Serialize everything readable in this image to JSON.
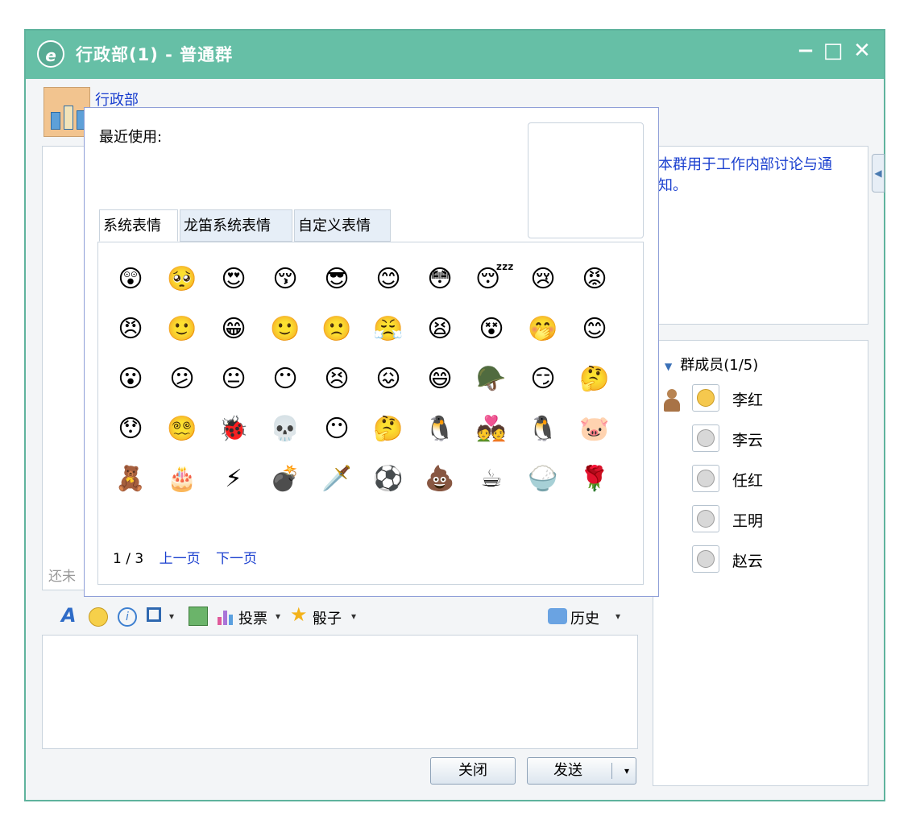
{
  "window": {
    "title": "行政部(1) - 普通群",
    "controls": {
      "minimize": "−",
      "maximize": "□",
      "close": "✕"
    },
    "accent": "#66bfa6"
  },
  "header": {
    "group_name": "行政部"
  },
  "chat": {
    "notice_cut": "还未"
  },
  "notice": {
    "text": "本群用于工作内部讨论与通知。"
  },
  "members": {
    "title": "群成员(1/5)",
    "list": [
      {
        "name": "李红",
        "online": true
      },
      {
        "name": "李云",
        "online": false
      },
      {
        "name": "任红",
        "online": false
      },
      {
        "name": "王明",
        "online": false
      },
      {
        "name": "赵云",
        "online": false
      }
    ]
  },
  "toolbar": {
    "vote_label": "投票",
    "dice_label": "骰子",
    "history_label": "历史",
    "caret": "▾"
  },
  "buttons": {
    "close": "关闭",
    "send": "发送",
    "send_caret": "▾"
  },
  "emoji_popup": {
    "recent_label": "最近使用:",
    "tabs": [
      "系统表情",
      "龙笛系统表情",
      "自定义表情"
    ],
    "pager": {
      "current": "1 / 3",
      "prev": "上一页",
      "next": "下一页"
    },
    "emojis": [
      "😲",
      "🥺",
      "😍",
      "😚",
      "😎",
      "😊",
      "😳",
      "😴",
      "😢",
      "😡",
      "😠",
      "🙂",
      "😁",
      "🙂",
      "🙁",
      "😤",
      "😫",
      "😵",
      "🤭",
      "😊",
      "😮",
      "😕",
      "😐",
      "😶",
      "😣",
      "😖",
      "😄",
      "🪖",
      "😏",
      "🤔",
      "😯",
      "😵‍💫",
      "🐞",
      "💀",
      "😶",
      "🤔",
      "🐧",
      "💑",
      "🐧",
      "🐷",
      "🧸",
      "🎂",
      "⚡",
      "💣",
      "🗡️",
      "⚽",
      "💩",
      "☕",
      "🍚",
      "🌹"
    ]
  }
}
